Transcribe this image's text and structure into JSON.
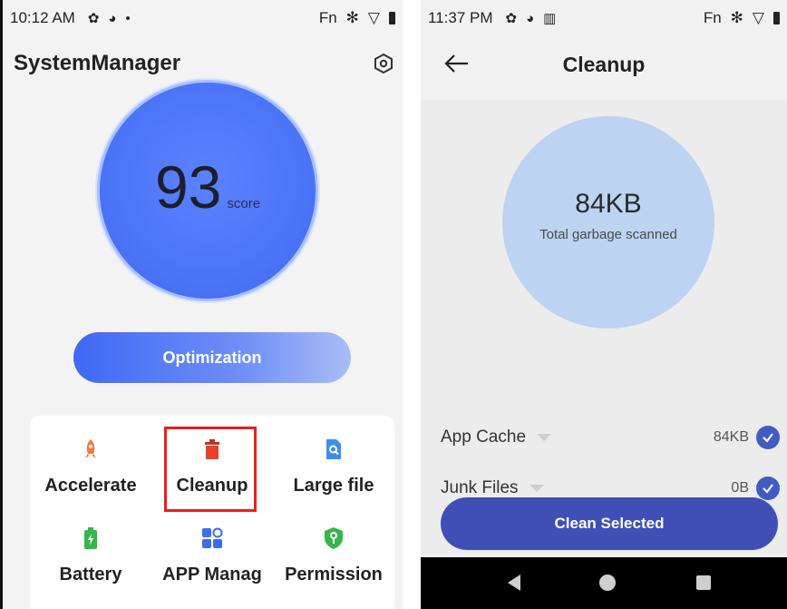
{
  "left": {
    "status": {
      "time": "10:12 AM",
      "dot": "•",
      "fn": "Fn"
    },
    "app_title": "SystemManager",
    "score": {
      "value": "93",
      "label": "score"
    },
    "optimize_label": "Optimization",
    "tools": [
      {
        "label": "Accelerate",
        "icon": "rocket-icon",
        "color": "#f07a3a"
      },
      {
        "label": "Cleanup",
        "icon": "trash-icon",
        "color": "#e8402a"
      },
      {
        "label": "Large file",
        "icon": "file-search-icon",
        "color": "#3b8ef0"
      },
      {
        "label": "Battery",
        "icon": "battery-icon",
        "color": "#36b54a"
      },
      {
        "label": "APP Manag",
        "icon": "apps-icon",
        "color": "#3b6ee8"
      },
      {
        "label": "Permission",
        "icon": "shield-key-icon",
        "color": "#36b54a"
      }
    ]
  },
  "right": {
    "status": {
      "time": "11:37 PM",
      "fn": "Fn"
    },
    "page_title": "Cleanup",
    "total": {
      "size": "84KB",
      "label": "Total garbage scanned"
    },
    "items": [
      {
        "name": "App Cache",
        "size": "84KB",
        "checked": true
      },
      {
        "name": "Junk Files",
        "size": "0B",
        "checked": true
      }
    ],
    "clean_label": "Clean Selected"
  },
  "colors": {
    "accent": "#4a73f6",
    "clean_button": "#3f4fb6",
    "highlight": "#e52020"
  }
}
